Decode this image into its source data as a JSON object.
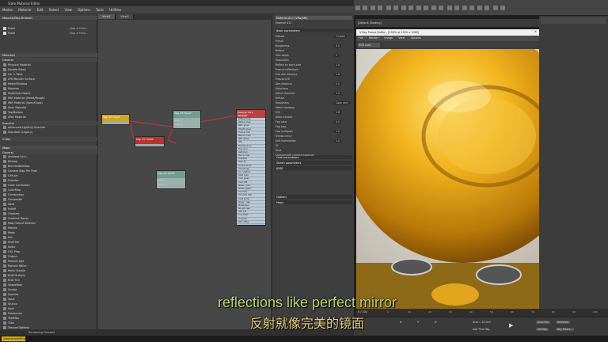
{
  "sme": {
    "title": "Slate Material Editor",
    "menu": [
      "Modes",
      "Material",
      "Edit",
      "Select",
      "View",
      "Options",
      "Tools",
      "Utilities"
    ],
    "browser_header": "Material/Map Browser",
    "browser_items_top": [
      "Fallof",
      "Fallof"
    ],
    "browser_items_top_right": [
      "Map #   Fallo...",
      "Map #   Fallo..."
    ],
    "section_materials": "Materials",
    "section_general": "General",
    "materials_general": [
      "Physical Material",
      "Double Sided",
      "Ink 'n Paint",
      "LPM Render Surface",
      "Matte/Shadow",
      "Morpher",
      "Multi/Sub-Object",
      "PBR Material (Metal/Rough)",
      "PBR Material (Spec/Gloss)",
      "Shell Material",
      "Top/Bottom",
      "XRef Material"
    ],
    "section_scanline": "Scanline",
    "scanline_items": [
      "Advanced Lighting Override",
      "Standard (Legacy)"
    ],
    "section_vray": "V-Ray",
    "section_maps": "Maps",
    "maps_general": [
      "Ambient Occl...",
      "Bitmap",
      "BlendedBoxMap",
      "Camera Map Per Pixel",
      "Cellular",
      "Checker",
      "Color Correction",
      "ColorMap",
      "Combustion",
      "Composite",
      "Dent",
      "Falloff",
      "Gradient",
      "Gradient Ramp",
      "Map Output Selector",
      "Marble",
      "Mask",
      "Mix",
      "MultiTile",
      "Noise",
      "OSL Map",
      "Output",
      "Particle Age",
      "Particle MBlur",
      "Perlin Marble",
      "RGB Multiply",
      "RGB Tint",
      "ShapeMap",
      "Smoke",
      "Speckle",
      "Splat",
      "Stucco",
      "Swirl",
      "Substance",
      "TextMap",
      "Tiles",
      "TextureObjMask",
      "Vector Displacement",
      "Vector Map"
    ],
    "view_tabs": [
      "View1",
      "View2"
    ],
    "node_vraymtl_title": "Material #11",
    "node_vraymtl_sub": "VRayMtl",
    "node_vraymtl_ports": [
      "Diffuse map",
      "Reflect map",
      "Refl. gloss.",
      "Hilight gloss",
      "Fresnel IOR",
      "Refract map",
      "Refl. gloss.",
      "IOR",
      "Translucency",
      "Fog color",
      "Self-Illum.",
      "Bump map",
      "Displace",
      "Opacity",
      "Environment",
      "Anisotropy",
      "An. rotation",
      "Coat color",
      "Coat gloss.",
      "Coat IOR",
      "Sheen color",
      "Sheen gloss.",
      "Thin film",
      "Thin film IOR",
      "Coat bump",
      "Sheen map",
      "Metalness",
      "Rough map",
      "GTR tail",
      "Fog depth",
      "Fog bias",
      "Refl. Metal"
    ],
    "node_falloff_a": "Map #4 Falloff",
    "node_falloff_b": "Map #5 Falloff",
    "node_falloff_c": "Map #7 Falloff",
    "node_falloff_d": "Map #8 Falloff",
    "node_ports_small": [
      "Color 1",
      "Color 2"
    ],
    "params_title": "Material #11 (VRayMtl)",
    "params_subtitle": "Material #11",
    "params_sections": [
      "Basic parameters",
      "Coat parameters",
      "Sheen parameters",
      "BRDF",
      "Options",
      "Maps"
    ],
    "params_rows": [
      "Diffuse",
      "Preset",
      "Roughness",
      "Reflect",
      "Max depth",
      "Glossiness",
      "Reflect on back side",
      "Fresnel reflections",
      "Use dim distance",
      "Fresnel IOR",
      "Dim distance",
      "Metalness",
      "Affect channels",
      "Refract",
      "Glossiness",
      "Affect shadows",
      "IOR",
      "Abbe number",
      "Fog color",
      "Fog bias",
      "Fog multiplier",
      "Translucency",
      "Self-illumination",
      "GI",
      "Mult",
      "Compensate camera exposure"
    ],
    "params_values": [
      "Custom",
      "0.0",
      "5",
      "1.0",
      "1.6",
      "0.0",
      "1.0",
      "Color only",
      "1.6",
      "0.0",
      "1.0",
      "1.0"
    ],
    "status_text": "Rendering Finished"
  },
  "vfb": {
    "title": "V-Ray Frame Buffer - [100% of 1920 x 1080]",
    "menu": [
      "File",
      "Render",
      "Image",
      "View",
      "Options"
    ],
    "channel": "RGB color"
  },
  "max": {
    "viewport_label": "[Default Shading]",
    "frame_counter": "0 / 100",
    "ticks": [
      "0",
      "10",
      "20",
      "30",
      "40",
      "50",
      "60",
      "70",
      "80",
      "90",
      "100"
    ],
    "coords": [
      "X:",
      "Y:",
      "Z:"
    ],
    "grid": "Grid = 10.0cm",
    "add_time_tag": "Add Time Tag",
    "auto_key": "Auto Key",
    "set_key": "Set Key",
    "selected": "Selected",
    "key_filters": "Key Filters..."
  },
  "subtitles": {
    "en": "reflections like perfect mirror",
    "zh": "反射就像完美的镜面"
  },
  "branding": {
    "logo": "www.ArtnetStudi.com",
    "accent": "#d6b100"
  }
}
